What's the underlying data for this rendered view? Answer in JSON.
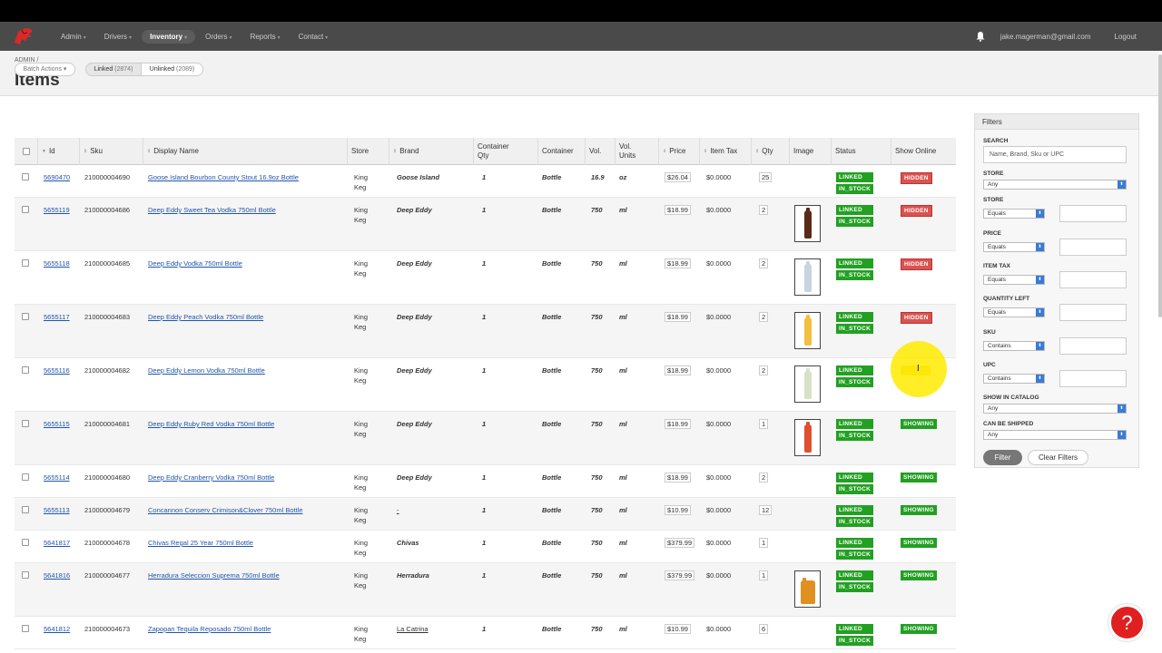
{
  "topbar": {
    "nav": [
      {
        "label": "Admin"
      },
      {
        "label": "Drivers"
      },
      {
        "label": "Inventory"
      },
      {
        "label": "Orders"
      },
      {
        "label": "Reports"
      },
      {
        "label": "Contact"
      }
    ],
    "active_nav": "Inventory",
    "user_email": "jake.magerman@gmail.com",
    "logout_label": "Logout"
  },
  "header": {
    "breadcrumb": "ADMIN /",
    "title": "Items"
  },
  "toolbar": {
    "batch_actions": "Batch Actions",
    "linked_label": "Linked",
    "linked_count": "(2874)",
    "unlinked_label": "Unlinked",
    "unlinked_count": "(2089)"
  },
  "table": {
    "columns": [
      "Id",
      "Sku",
      "Display Name",
      "Store",
      "Brand",
      "Container Qty",
      "Container",
      "Vol.",
      "Vol. Units",
      "Price",
      "Item Tax",
      "Qty",
      "Image",
      "Status",
      "Show Online"
    ],
    "rows": [
      {
        "id": "5690470",
        "sku": "210000004690",
        "name": "Goose Island Bourbon County Stout 16.9oz Bottle",
        "store": "King Keg",
        "brand": "Goose Island",
        "cqty": "1",
        "container": "Bottle",
        "vol": "16.9",
        "units": "oz",
        "price": "$26.04",
        "tax": "$0.0000",
        "qty": "25",
        "image": "",
        "status1": "LINKED",
        "status2": "IN_STOCK",
        "online": "HIDDEN"
      },
      {
        "id": "5655119",
        "sku": "210000004686",
        "name": "Deep Eddy Sweet Tea Vodka 750ml Bottle",
        "store": "King Keg",
        "brand": "Deep Eddy",
        "cqty": "1",
        "container": "Bottle",
        "vol": "750",
        "units": "ml",
        "price": "$18.99",
        "tax": "$0.0000",
        "qty": "2",
        "image": "bottle-dark",
        "status1": "LINKED",
        "status2": "IN_STOCK",
        "online": "HIDDEN"
      },
      {
        "id": "5655118",
        "sku": "210000004685",
        "name": "Deep Eddy Vodka 750ml Bottle",
        "store": "King Keg",
        "brand": "Deep Eddy",
        "cqty": "1",
        "container": "Bottle",
        "vol": "750",
        "units": "ml",
        "price": "$18.99",
        "tax": "$0.0000",
        "qty": "2",
        "image": "bottle-clear",
        "status1": "LINKED",
        "status2": "IN_STOCK",
        "online": "HIDDEN"
      },
      {
        "id": "5655117",
        "sku": "210000004683",
        "name": "Deep Eddy Peach Vodka 750ml Bottle",
        "store": "King Keg",
        "brand": "Deep Eddy",
        "cqty": "1",
        "container": "Bottle",
        "vol": "750",
        "units": "ml",
        "price": "$18.99",
        "tax": "$0.0000",
        "qty": "2",
        "image": "bottle-peach",
        "status1": "LINKED",
        "status2": "IN_STOCK",
        "online": "HIDDEN"
      },
      {
        "id": "5655116",
        "sku": "210000004682",
        "name": "Deep Eddy Lemon Vodka 750ml Bottle",
        "store": "King Keg",
        "brand": "Deep Eddy",
        "cqty": "1",
        "container": "Bottle",
        "vol": "750",
        "units": "ml",
        "price": "$18.99",
        "tax": "$0.0000",
        "qty": "2",
        "image": "bottle-lemon",
        "status1": "LINKED",
        "status2": "IN_STOCK",
        "online": "HIDDEN"
      },
      {
        "id": "5655115",
        "sku": "210000004681",
        "name": "Deep Eddy Ruby Red Vodka 750ml Bottle",
        "store": "King Keg",
        "brand": "Deep Eddy",
        "cqty": "1",
        "container": "Bottle",
        "vol": "750",
        "units": "ml",
        "price": "$18.99",
        "tax": "$0.0000",
        "qty": "1",
        "image": "bottle-ruby",
        "status1": "LINKED",
        "status2": "IN_STOCK",
        "online": "SHOWING"
      },
      {
        "id": "5655114",
        "sku": "210000004680",
        "name": "Deep Eddy Cranberry Vodka 750ml Bottle",
        "store": "King Keg",
        "brand": "Deep Eddy",
        "cqty": "1",
        "container": "Bottle",
        "vol": "750",
        "units": "ml",
        "price": "$18.99",
        "tax": "$0.0000",
        "qty": "2",
        "image": "",
        "status1": "LINKED",
        "status2": "IN_STOCK",
        "online": "SHOWING"
      },
      {
        "id": "5655113",
        "sku": "210000004679",
        "name": "Concannon Conserv Crimison&Clover 750ml Bottle",
        "store": "King Keg",
        "brand": "-",
        "cqty": "1",
        "container": "Bottle",
        "vol": "750",
        "units": "ml",
        "price": "$10.99",
        "tax": "$0.0000",
        "qty": "12",
        "image": "",
        "status1": "LINKED",
        "status2": "IN_STOCK",
        "online": "SHOWING"
      },
      {
        "id": "5641817",
        "sku": "210000004678",
        "name": "Chivas Regal 25 Year 750ml Bottle",
        "store": "King Keg",
        "brand": "Chivas",
        "cqty": "1",
        "container": "Bottle",
        "vol": "750",
        "units": "ml",
        "price": "$379.99",
        "tax": "$0.0000",
        "qty": "1",
        "image": "",
        "status1": "LINKED",
        "status2": "IN_STOCK",
        "online": "SHOWING"
      },
      {
        "id": "5641816",
        "sku": "210000004677",
        "name": "Herradura Seleccion Suprema 750ml Bottle",
        "store": "King Keg",
        "brand": "Herradura",
        "cqty": "1",
        "container": "Bottle",
        "vol": "750",
        "units": "ml",
        "price": "$379.99",
        "tax": "$0.0000",
        "qty": "1",
        "image": "bottle-tequila",
        "status1": "LINKED",
        "status2": "IN_STOCK",
        "online": "SHOWING"
      },
      {
        "id": "5641812",
        "sku": "210000004673",
        "name": "Zapopan Tequila Reposado 750ml Bottle",
        "store": "King Keg",
        "brand": "La Catrina",
        "cqty": "1",
        "container": "Bottle",
        "vol": "750",
        "units": "ml",
        "price": "$10.99",
        "tax": "$0.0000",
        "qty": "6",
        "image": "",
        "status1": "LINKED",
        "status2": "IN_STOCK",
        "online": "SHOWING"
      }
    ]
  },
  "filters": {
    "title": "Filters",
    "search_label": "SEARCH",
    "search_placeholder": "Name, Brand, Sku or UPC",
    "store1_label": "STORE",
    "store1_value": "Any",
    "store2_label": "STORE",
    "store2_value": "Equals",
    "price_label": "PRICE",
    "price_value": "Equals",
    "tax_label": "ITEM TAX",
    "tax_value": "Equals",
    "qty_label": "QUANTITY LEFT",
    "qty_value": "Equals",
    "sku_label": "SKU",
    "sku_value": "Contains",
    "upc_label": "UPC",
    "upc_value": "Contains",
    "catalog_label": "SHOW IN CATALOG",
    "catalog_value": "Any",
    "ship_label": "CAN BE SHIPPED",
    "ship_value": "Any",
    "filter_btn": "Filter",
    "clear_btn": "Clear Filters"
  },
  "colors": {
    "accent": "#3a7bd5",
    "linked": "#22a022",
    "hidden": "#d9534f",
    "help": "#e02020"
  }
}
